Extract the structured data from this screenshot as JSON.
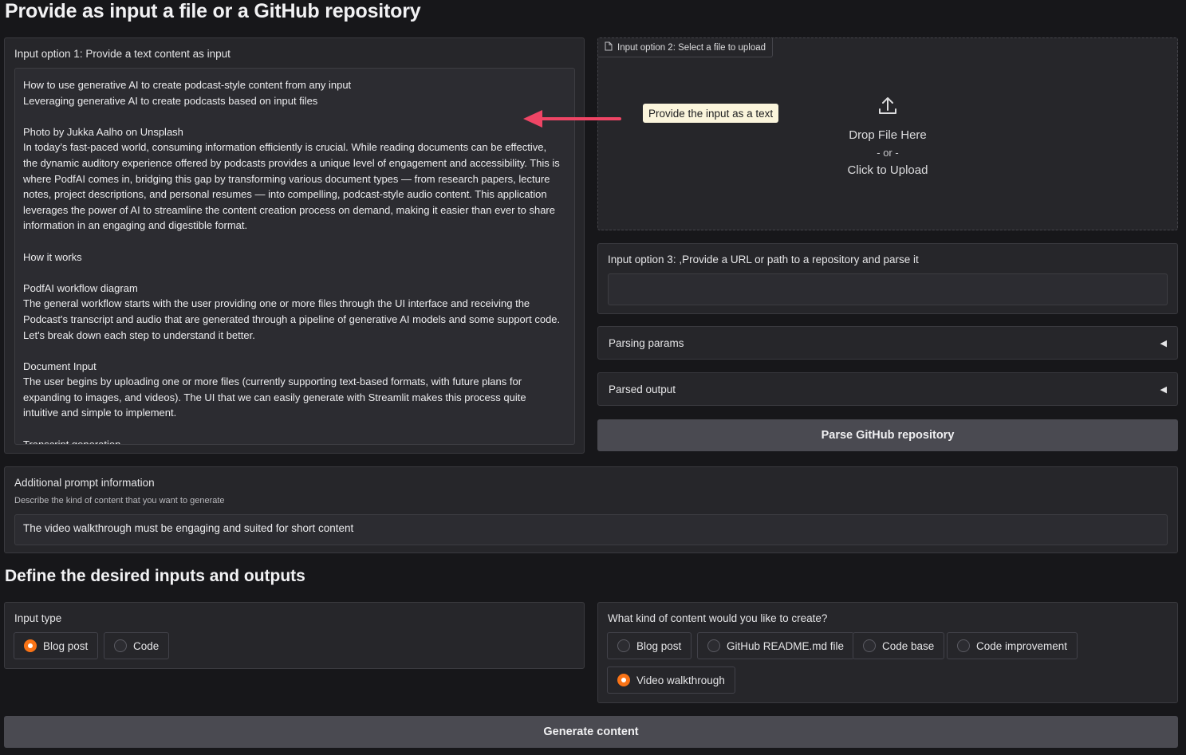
{
  "page": {
    "title": "Provide as input a file or a GitHub repository",
    "section2_title": "Define the desired inputs and outputs"
  },
  "option1": {
    "label": "Input option 1: Provide a text content as input",
    "lines": [
      "How to use generative AI to create podcast-style content from any input",
      "Leveraging generative AI to create podcasts based on input files",
      "",
      "Photo by Jukka Aalho on Unsplash",
      "In today’s fast-paced world, consuming information efficiently is crucial. While reading documents can be effective,",
      "the dynamic auditory experience offered by podcasts provides a unique level of engagement and accessibility. This is",
      "where PodfAI comes in, bridging this gap by transforming various document types — from research papers, lecture",
      "notes, project descriptions, and personal resumes — into compelling, podcast-style audio content. This application",
      "leverages the power of AI to streamline the content creation process on demand, making it easier than ever to share",
      "information in an engaging and digestible format.",
      "",
      "How it works",
      "",
      "PodfAI workflow diagram",
      "The general workflow starts with the user providing one or more files through the UI interface and receiving the",
      "Podcast's transcript and audio that are generated through a pipeline of generative AI models and some support code.",
      "Let's break down each step to understand it better.",
      "",
      "Document Input",
      "The user begins by uploading one or more files (currently supporting text-based formats, with future plans for",
      "expanding to images, and videos). The UI that we can easily generate with Streamlit makes this process quite",
      "intuitive and simple to implement.",
      "",
      "Transcript generation"
    ]
  },
  "option2": {
    "tab_label": "Input option 2: Select a file to upload",
    "drop_text": "Drop File Here",
    "or_text": "- or -",
    "click_text": "Click to Upload"
  },
  "tooltip": "Provide the input as a text",
  "option3": {
    "label": "Input option 3: ,Provide a URL or path to a repository and parse it",
    "value": ""
  },
  "accordions": {
    "parsing": "Parsing params",
    "parsed": "Parsed output",
    "icon": "◀"
  },
  "parse_button": "Parse GitHub repository",
  "additional": {
    "label": "Additional prompt information",
    "sublabel": "Describe the kind of content that you want to generate",
    "value": "The video walkthrough must be engaging and suited for short content"
  },
  "input_type": {
    "label": "Input type",
    "options": [
      "Blog post",
      "Code"
    ],
    "selected": "Blog post"
  },
  "content_kind": {
    "label": "What kind of content would you like to create?",
    "options": [
      "Blog post",
      "GitHub README.md file",
      "Code base",
      "Code improvement",
      "Video walkthrough"
    ],
    "selected": "Video walkthrough"
  },
  "generate_button": "Generate content",
  "colors": {
    "accent": "#f97316",
    "arrow": "#ef4565",
    "tooltip_bg": "#fbf5dc"
  },
  "icons": [
    "file-icon",
    "upload-icon",
    "arrow-left-icon",
    "triangle-left-icon"
  ]
}
